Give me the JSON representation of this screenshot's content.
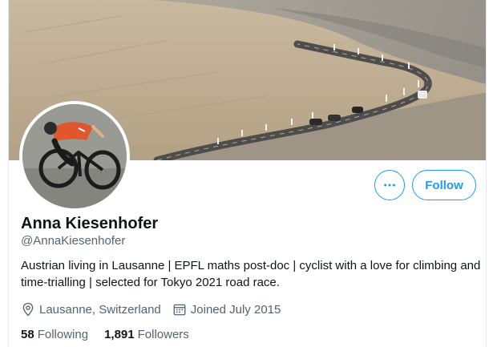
{
  "profile": {
    "name": "Anna Kiesenhofer",
    "handle": "@AnnaKiesenhofer",
    "bio": "Austrian living in Lausanne | EPFL maths post-doc | cyclist with a love for climbing and time-trialling | selected for Tokyo 2021 road race.",
    "location": "Lausanne, Switzerland",
    "joined": "Joined July 2015",
    "location_icon": "location-pin-icon",
    "calendar_icon": "calendar-icon"
  },
  "actions": {
    "more_icon": "more-horizontal-icon",
    "follow_label": "Follow"
  },
  "stats": {
    "following_count": "58",
    "following_label": "Following",
    "followers_count": "1,891",
    "followers_label": "Followers"
  },
  "colors": {
    "accent": "#1d9bf0",
    "text_primary": "#0f1419",
    "text_secondary": "#536471"
  }
}
